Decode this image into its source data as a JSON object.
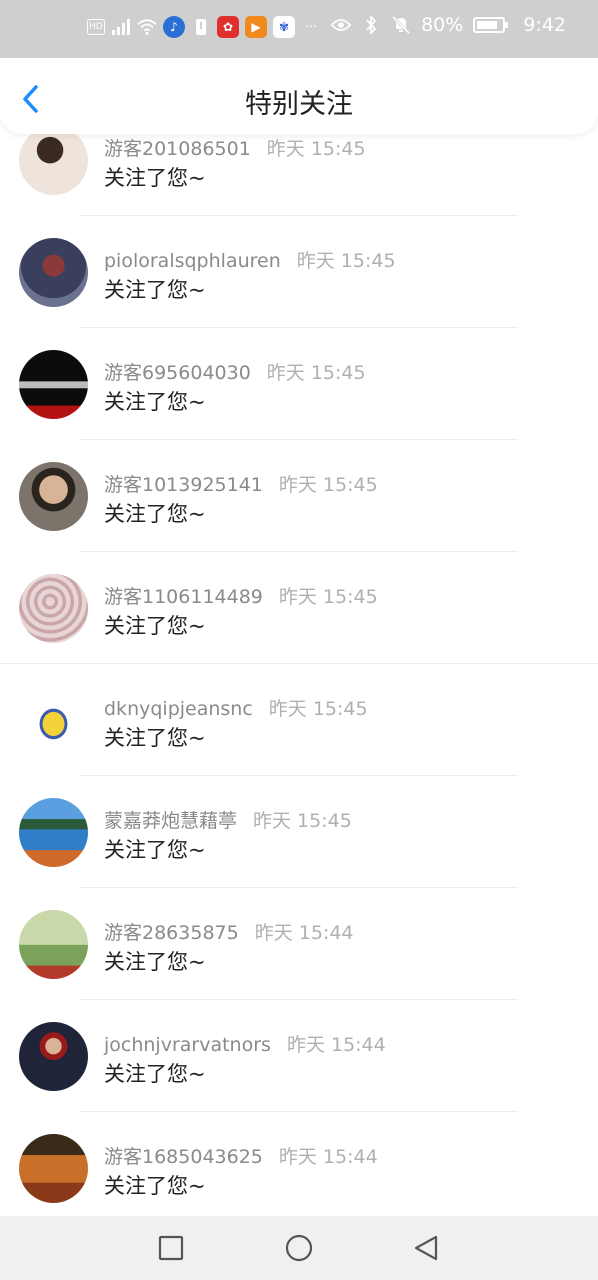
{
  "status_bar": {
    "battery_percent": "80%",
    "time": "9:42",
    "indicators": [
      "hd-icon",
      "4g-signal-icon",
      "wifi-icon",
      "app-notify-icon",
      "sim-icon",
      "huawei-app-icon",
      "video-app-icon",
      "baidu-app-icon",
      "more-dots-icon",
      "eye-icon",
      "bluetooth-icon",
      "mute-icon",
      "battery-icon"
    ]
  },
  "header": {
    "title": "特别关注",
    "back_icon": "chevron-left-icon",
    "accent_color": "#1a8cff"
  },
  "list": {
    "items": [
      {
        "name": "游客201086501",
        "time": "昨天 15:45",
        "message": "关注了您~",
        "avatar_color": "#e7d8cf"
      },
      {
        "name": "pioloralsqphlauren",
        "time": "昨天 15:45",
        "message": "关注了您~",
        "avatar_color": "#4b4f6e"
      },
      {
        "name": "游客695604030",
        "time": "昨天 15:45",
        "message": "关注了您~",
        "avatar_color": "#111111"
      },
      {
        "name": "游客1013925141",
        "time": "昨天 15:45",
        "message": "关注了您~",
        "avatar_color": "#5b5347"
      },
      {
        "name": "游客1106114489",
        "time": "昨天 15:45",
        "message": "关注了您~",
        "avatar_color": "#d8c5c6"
      },
      {
        "name": "dknyqipjeansnc",
        "time": "昨天 15:45",
        "message": "关注了您~",
        "avatar_color": "#f4d33a"
      },
      {
        "name": "蒙嘉莽炮慧藉葶",
        "time": "昨天 15:45",
        "message": "关注了您~",
        "avatar_color": "#3a7fc0"
      },
      {
        "name": "游客28635875",
        "time": "昨天 15:44",
        "message": "关注了您~",
        "avatar_color": "#7aa25a"
      },
      {
        "name": "jochnjvrarvatnors",
        "time": "昨天 15:44",
        "message": "关注了您~",
        "avatar_color": "#2b2f45"
      },
      {
        "name": "游客1685043625",
        "time": "昨天 15:44",
        "message": "关注了您~",
        "avatar_color": "#b85a23"
      }
    ]
  },
  "navbar": {
    "buttons": [
      "square-recent-icon",
      "circle-home-icon",
      "triangle-back-icon"
    ]
  }
}
